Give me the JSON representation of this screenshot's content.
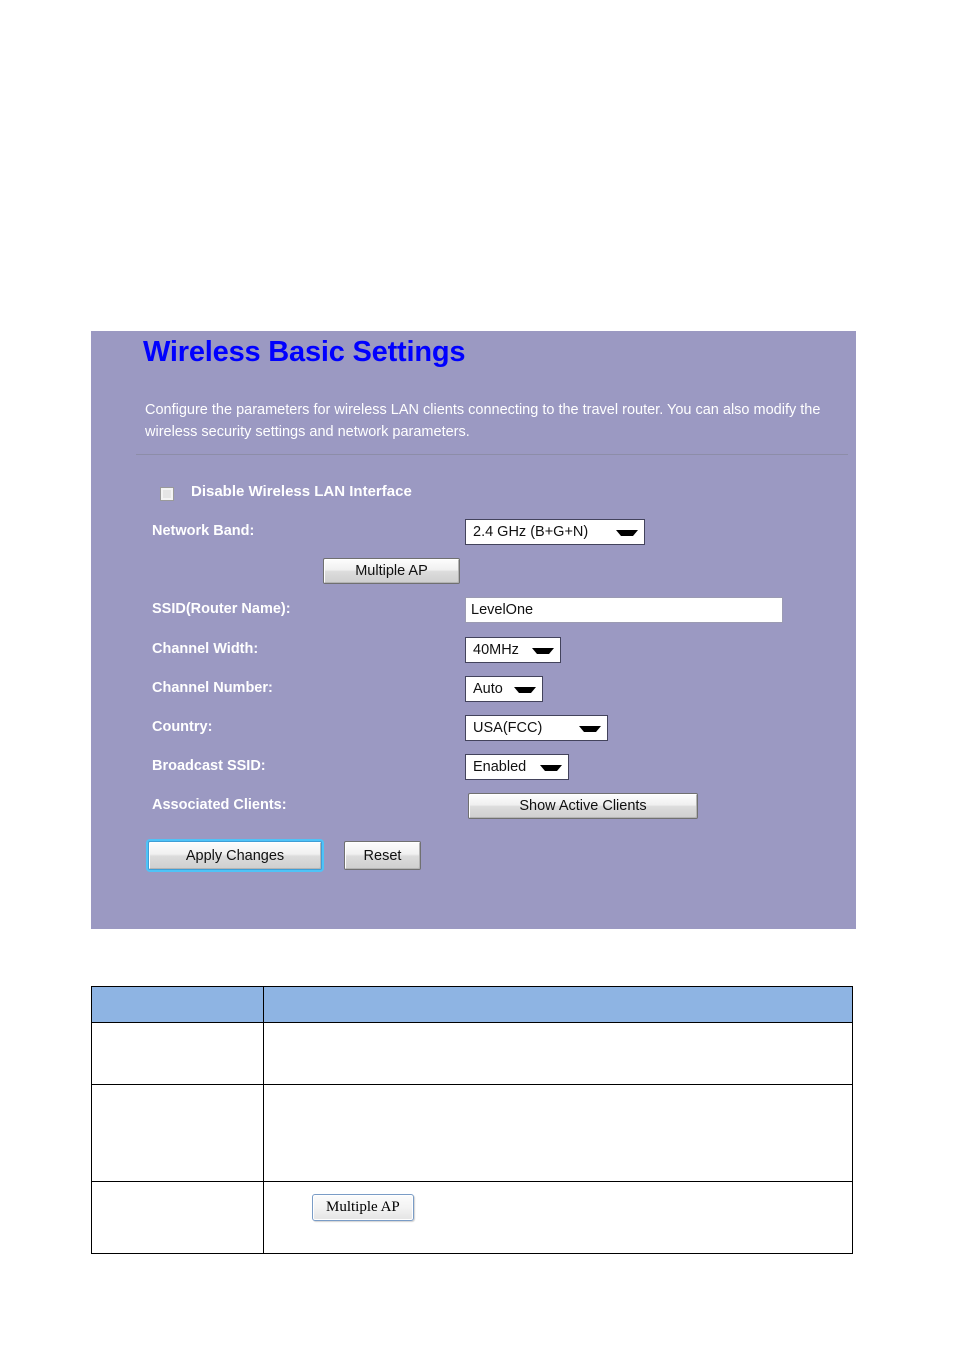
{
  "panel": {
    "title": "Wireless Basic Settings",
    "description": "Configure the parameters for wireless LAN clients connecting to the travel router. You can also modify the wireless security settings and network parameters.",
    "disable_wlan": {
      "label": "Disable Wireless LAN Interface",
      "checked": false
    },
    "fields": {
      "network_band": {
        "label": "Network Band:",
        "value": "2.4 GHz (B+G+N)"
      },
      "multiple_ap": {
        "label": "Multiple AP"
      },
      "ssid": {
        "label": "SSID(Router Name):",
        "value": "LevelOne"
      },
      "channel_width": {
        "label": "Channel Width:",
        "value": "40MHz"
      },
      "channel_number": {
        "label": "Channel Number:",
        "value": "Auto"
      },
      "country": {
        "label": "Country:",
        "value": "USA(FCC)"
      },
      "broadcast_ssid": {
        "label": "Broadcast SSID:",
        "value": "Enabled"
      },
      "associated_clients": {
        "label": "Associated Clients:",
        "button_label": "Show Active Clients"
      }
    },
    "actions": {
      "apply_label": "Apply Changes",
      "reset_label": "Reset"
    },
    "colors": {
      "panel_background": "#9b99c2",
      "title": "#0000ff",
      "text": "#ffffff"
    }
  },
  "doc_table": {
    "header": {
      "col_a": "",
      "col_b": ""
    },
    "rows": [
      {
        "col_a": "",
        "col_b": "",
        "button": null
      },
      {
        "col_a": "",
        "col_b": "",
        "button": null
      },
      {
        "col_a": "",
        "col_b": "",
        "button": "Multiple AP"
      }
    ],
    "colors": {
      "header_background": "#8eb4e3",
      "border": "#000000"
    }
  }
}
